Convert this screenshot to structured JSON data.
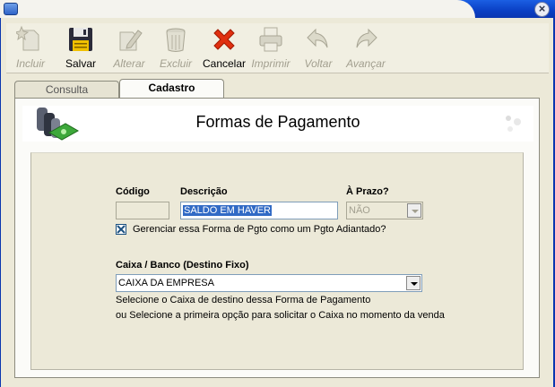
{
  "toolbar": {
    "buttons": [
      {
        "label": "Incluir",
        "icon": "new-document-icon",
        "enabled": false
      },
      {
        "label": "Salvar",
        "icon": "floppy-disk-icon",
        "enabled": true
      },
      {
        "label": "Alterar",
        "icon": "edit-document-icon",
        "enabled": false
      },
      {
        "label": "Excluir",
        "icon": "trash-can-icon",
        "enabled": false
      },
      {
        "label": "Cancelar",
        "icon": "red-x-icon",
        "enabled": true
      },
      {
        "label": "Imprimir",
        "icon": "printer-icon",
        "enabled": false
      },
      {
        "label": "Voltar",
        "icon": "back-arrow-icon",
        "enabled": false
      },
      {
        "label": "Avançar",
        "icon": "forward-arrow-icon",
        "enabled": false
      }
    ]
  },
  "tabs": [
    {
      "label": "Consulta",
      "active": false
    },
    {
      "label": "Cadastro",
      "active": true
    }
  ],
  "header": {
    "title": "Formas de Pagamento"
  },
  "form": {
    "codigo_label": "Código",
    "codigo_value": "",
    "descricao_label": "Descrição",
    "descricao_value": "SALDO EM HAVER",
    "aprazo_label": "À Prazo?",
    "aprazo_value": "NÃO",
    "adiantado_checked": true,
    "adiantado_label": "Gerenciar essa Forma de Pgto como um Pgto Adiantado?",
    "caixa_label": "Caixa / Banco (Destino Fixo)",
    "caixa_value": "CAIXA DA EMPRESA",
    "help_line1": "Selecione o Caixa de destino dessa Forma de Pagamento",
    "help_line2": "ou Selecione a primeira opção para solicitar o Caixa no momento da venda"
  },
  "colors": {
    "title_bar": "#0a3fc4",
    "selection": "#316ac5",
    "disabled_text": "#a29f8f"
  }
}
